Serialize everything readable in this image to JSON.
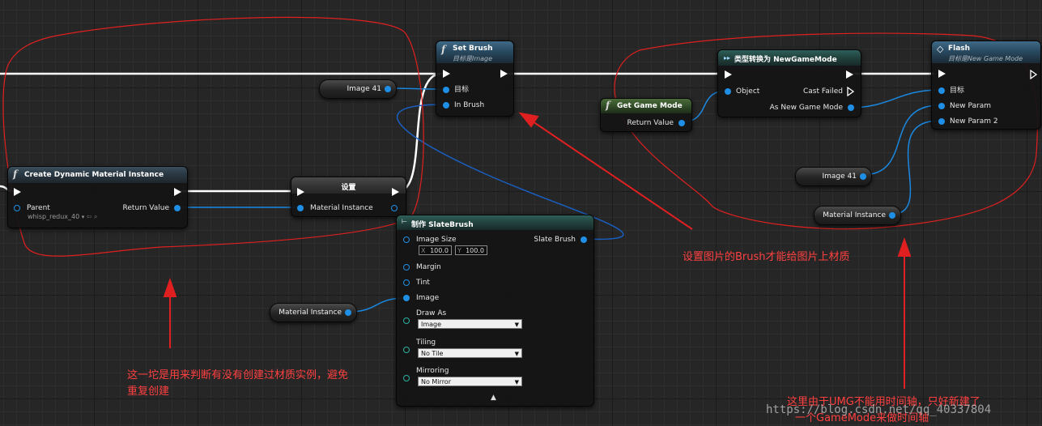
{
  "nodes": {
    "set_brush": {
      "title": "Set Brush",
      "subtitle": "目标是Image",
      "pins": {
        "target": "目标",
        "in_brush": "In Brush"
      }
    },
    "cast": {
      "title": "类型转换为 NewGameMode",
      "pins": {
        "object": "Object",
        "cast_failed": "Cast Failed",
        "as": "As New Game Mode"
      }
    },
    "flash": {
      "title": "Flash",
      "subtitle": "目标是New Game Mode",
      "pins": {
        "target": "目标",
        "param1": "New Param",
        "param2": "New Param 2"
      }
    },
    "get_game_mode": {
      "title": "Get Game Mode",
      "pins": {
        "return_value": "Return Value"
      }
    },
    "create_dmi": {
      "title": "Create Dynamic Material Instance",
      "pins": {
        "parent": "Parent",
        "parent_value": "whisp_redux_40",
        "return_value": "Return Value"
      }
    },
    "set_var": {
      "title": "设置",
      "pins": {
        "material_instance": "Material Instance"
      }
    },
    "make_slate_brush": {
      "title": "制作 SlateBrush",
      "pins": {
        "image_size": "Image Size",
        "size_x_label": "X",
        "size_x": "100.0",
        "size_y_label": "Y",
        "size_y": "100.0",
        "slate_brush": "Slate Brush",
        "margin": "Margin",
        "tint": "Tint",
        "image": "Image",
        "draw_as": "Draw As",
        "draw_as_value": "Image",
        "tiling": "Tiling",
        "tiling_value": "No Tile",
        "mirroring": "Mirroring",
        "mirroring_value": "No Mirror"
      }
    }
  },
  "variables": {
    "image41_a": "Image 41",
    "image41_b": "Image 41",
    "material_instance_a": "Material Instance",
    "material_instance_b": "Material Instance"
  },
  "annotations": {
    "brush_note": "设置图片的Brush才能给图片上材质",
    "dmi_note_line1": "这一坨是用来判断有没有创建过材质实例，避免",
    "dmi_note_line2": "重复创建",
    "gamemode_note_line1": "这里由于UMG不能用时间轴，只好新建了",
    "gamemode_note_line2": "一个GameMode来做时间轴"
  },
  "watermark": "https://blog.csdn.net/qq_40337804",
  "colors": {
    "annotation": "#ff4040",
    "object_pin": "#1f8fe5",
    "exec_wire": "#ffffff"
  }
}
